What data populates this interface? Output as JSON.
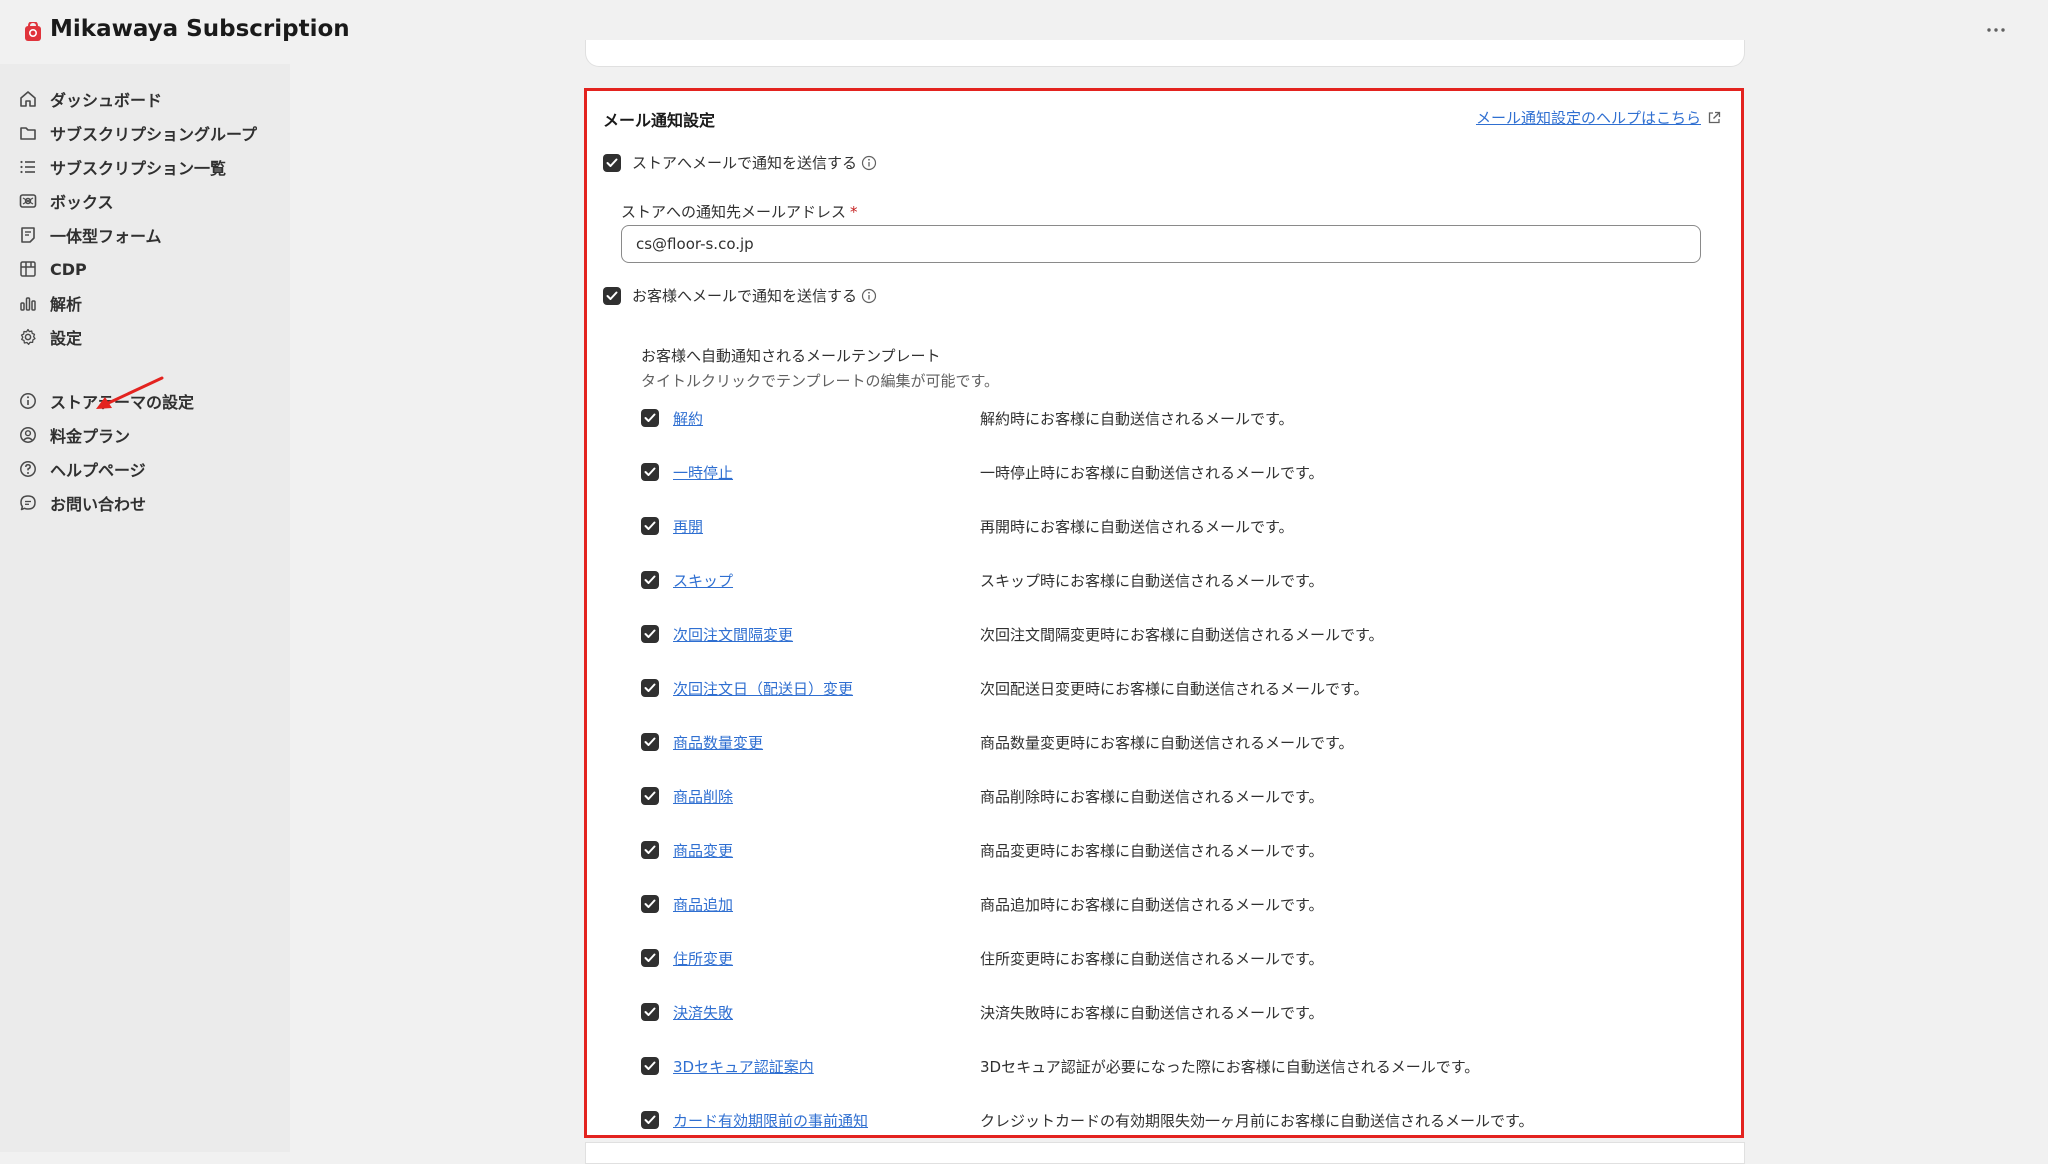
{
  "app": {
    "title": "Mikawaya Subscription"
  },
  "sidebar": {
    "items": [
      {
        "label": "ダッシュボード",
        "icon": "home-icon"
      },
      {
        "label": "サブスクリプショングループ",
        "icon": "folder-icon"
      },
      {
        "label": "サブスクリプション一覧",
        "icon": "list-icon"
      },
      {
        "label": "ボックス",
        "icon": "box-icon"
      },
      {
        "label": "一体型フォーム",
        "icon": "form-icon"
      },
      {
        "label": "CDP",
        "icon": "grid-icon"
      },
      {
        "label": "解析",
        "icon": "chart-icon"
      },
      {
        "label": "設定",
        "icon": "gear-icon"
      }
    ],
    "items2": [
      {
        "label": "ストアテーマの設定",
        "icon": "info-icon"
      },
      {
        "label": "料金プラン",
        "icon": "person-icon"
      },
      {
        "label": "ヘルプページ",
        "icon": "help-icon"
      },
      {
        "label": "お問い合わせ",
        "icon": "chat-icon"
      }
    ]
  },
  "mail": {
    "title": "メール通知設定",
    "help_link": "メール通知設定のヘルプはこちら",
    "store_toggle": {
      "label": "ストアへメールで通知を送信する",
      "checked": true
    },
    "store_email": {
      "label": "ストアへの通知先メールアドレス",
      "required_mark": "*",
      "value": "cs@floor-s.co.jp"
    },
    "customer_toggle": {
      "label": "お客様へメールで通知を送信する",
      "checked": true
    },
    "templates_heading": "お客様へ自動通知されるメールテンプレート",
    "templates_subheading": "タイトルクリックでテンプレートの編集が可能です。",
    "templates": [
      {
        "name": "解約",
        "description": "解約時にお客様に自動送信されるメールです。",
        "checked": true
      },
      {
        "name": "一時停止",
        "description": "一時停止時にお客様に自動送信されるメールです。",
        "checked": true
      },
      {
        "name": "再開",
        "description": "再開時にお客様に自動送信されるメールです。",
        "checked": true
      },
      {
        "name": "スキップ",
        "description": "スキップ時にお客様に自動送信されるメールです。",
        "checked": true
      },
      {
        "name": "次回注文間隔変更",
        "description": "次回注文間隔変更時にお客様に自動送信されるメールです。",
        "checked": true
      },
      {
        "name": "次回注文日（配送日）変更",
        "description": "次回配送日変更時にお客様に自動送信されるメールです。",
        "checked": true
      },
      {
        "name": "商品数量変更",
        "description": "商品数量変更時にお客様に自動送信されるメールです。",
        "checked": true
      },
      {
        "name": "商品削除",
        "description": "商品削除時にお客様に自動送信されるメールです。",
        "checked": true
      },
      {
        "name": "商品変更",
        "description": "商品変更時にお客様に自動送信されるメールです。",
        "checked": true
      },
      {
        "name": "商品追加",
        "description": "商品追加時にお客様に自動送信されるメールです。",
        "checked": true
      },
      {
        "name": "住所変更",
        "description": "住所変更時にお客様に自動送信されるメールです。",
        "checked": true
      },
      {
        "name": "決済失敗",
        "description": "決済失敗時にお客様に自動送信されるメールです。",
        "checked": true
      },
      {
        "name": "3Dセキュア認証案内",
        "description": "3Dセキュア認証が必要になった際にお客様に自動送信されるメールです。",
        "checked": true
      },
      {
        "name": "カード有効期限前の事前通知",
        "description": "クレジットカードの有効期限失効一ヶ月前にお客様に自動送信されるメールです。",
        "checked": true
      }
    ]
  },
  "colors": {
    "highlight": "#e3231f",
    "link": "#2f6fd1",
    "checkbox": "#303030",
    "logo": "#e0343c"
  }
}
